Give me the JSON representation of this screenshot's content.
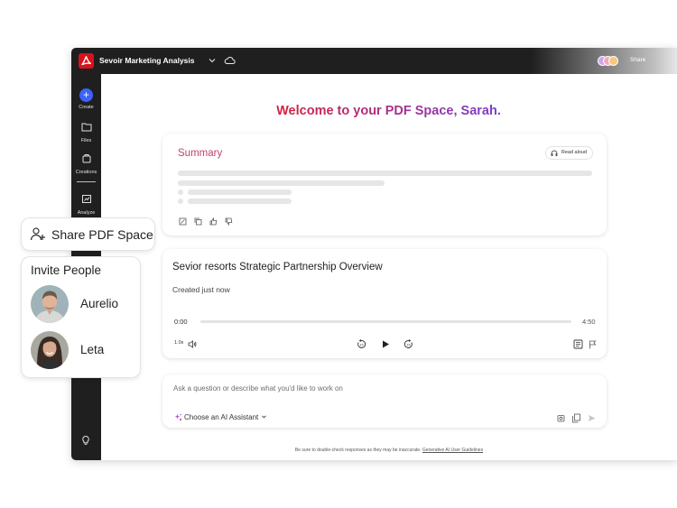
{
  "app": {
    "document_title": "Sevoir Marketing Analysis",
    "share_label": "Share",
    "brand_color": "#d7121c"
  },
  "rail": {
    "items": [
      {
        "label": "Create",
        "icon": "plus-icon"
      },
      {
        "label": "Files",
        "icon": "folder-icon"
      },
      {
        "label": "Creations",
        "icon": "creations-icon"
      },
      {
        "label": "Analyze",
        "icon": "analyze-icon"
      }
    ],
    "bottom_icon": "lightbulb-icon"
  },
  "main": {
    "welcome": "Welcome to your PDF Space, Sarah.",
    "welcome_gradient": [
      "#d4213d",
      "#7a3fd0"
    ],
    "summary": {
      "title": "Summary",
      "read_aloud_label": "Read aloud",
      "actions": [
        "edit-icon",
        "copy-icon",
        "thumbs-up-icon",
        "thumbs-down-icon"
      ]
    },
    "audio": {
      "title": "Sevior resorts Strategic Partnership Overview",
      "subtitle": "Created just now",
      "time_current": "0:00",
      "time_total": "4:50",
      "progress": 0,
      "speed": "1.0x"
    },
    "prompt": {
      "placeholder": "Ask a question or describe what you'd like to work on",
      "assistant_label": "Choose an AI Assistant"
    },
    "disclaimer": {
      "text": "Be sure to double-check responses as they may be inaccurate.",
      "link": "Generative AI User Guidelines"
    }
  },
  "callouts": {
    "share_space": "Share PDF Space",
    "invite": {
      "title": "Invite People",
      "people": [
        {
          "name": "Aurelio"
        },
        {
          "name": "Leta"
        }
      ]
    }
  }
}
